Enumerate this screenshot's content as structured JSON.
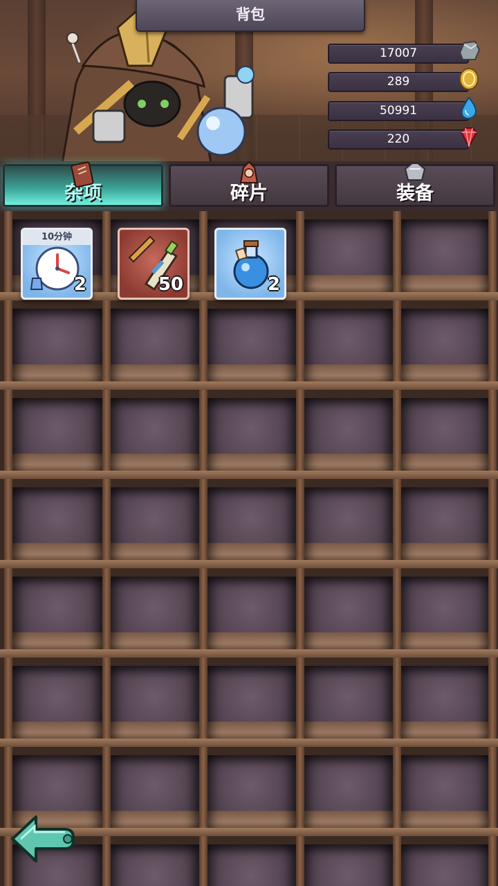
{
  "title": "背包",
  "currencies": [
    {
      "name": "stone",
      "value": "17007",
      "icon": "stone-icon",
      "color": "#9aa3a8"
    },
    {
      "name": "gold",
      "value": "289",
      "icon": "gold-coin-icon",
      "color": "#e2b23a"
    },
    {
      "name": "water",
      "value": "50991",
      "icon": "water-drop-icon",
      "color": "#3aa7e8"
    },
    {
      "name": "gem",
      "value": "220",
      "icon": "red-gem-icon",
      "color": "#e3303a"
    }
  ],
  "tabs": [
    {
      "label": "杂项",
      "icon": "scroll-book-icon",
      "active": true
    },
    {
      "label": "碎片",
      "icon": "hero-shard-icon",
      "active": false
    },
    {
      "label": "装备",
      "icon": "armor-icon",
      "active": false
    }
  ],
  "items": [
    {
      "name": "time-potion",
      "tag": "10分钟",
      "count": "2",
      "icon": "clock-potion-icon",
      "style": "blue"
    },
    {
      "name": "brush-bottle",
      "count": "50",
      "icon": "brush-bottle-icon",
      "style": "red"
    },
    {
      "name": "blue-potion",
      "count": "2",
      "icon": "blue-potion-icon",
      "style": "blue"
    }
  ],
  "colors": {
    "active_tab": "#3ea79b",
    "shelf_wood": "#8a6248",
    "back_button": "#5fc7b0"
  }
}
